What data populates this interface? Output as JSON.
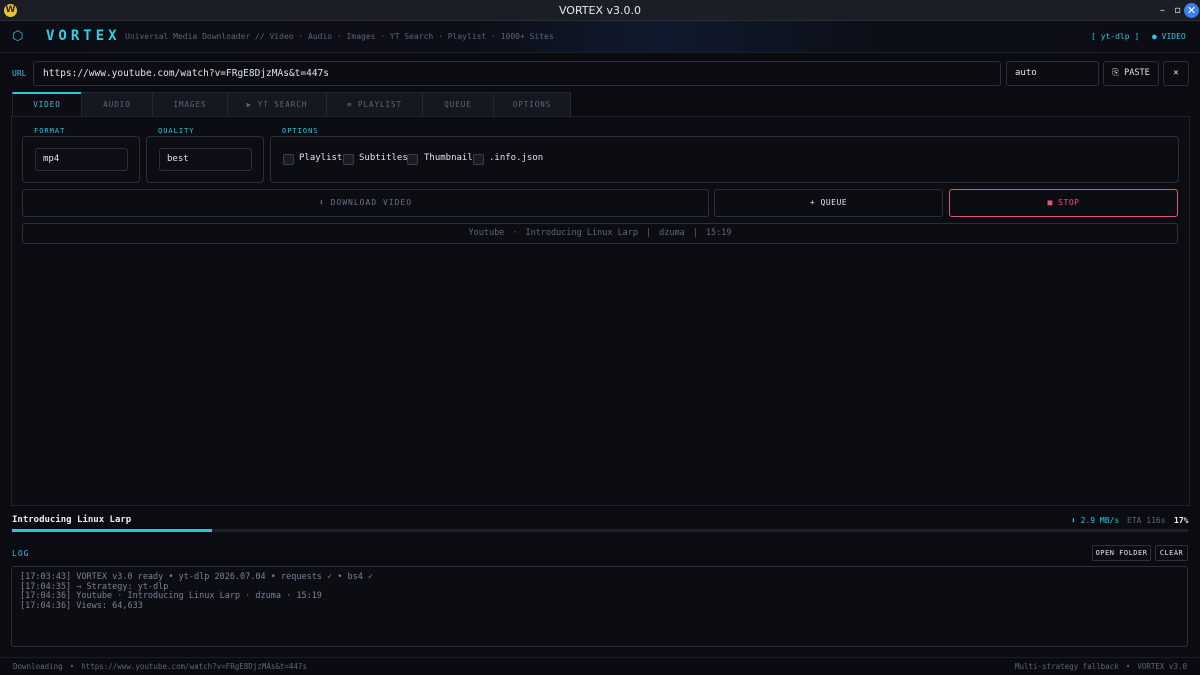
{
  "window": {
    "title": "VORTEX v3.0.0",
    "app_icon": "W",
    "minimize_glyph": "–",
    "maximize_glyph": "▫",
    "close_glyph": "✕"
  },
  "header": {
    "logo_icon": "⬡",
    "logo": "VORTEX",
    "tagline": "Universal Media Downloader  //  Video · Audio · Images · YT Search · Playlist · 1000+ Sites",
    "engine": "[ yt-dlp ]",
    "mode": "● VIDEO"
  },
  "url_row": {
    "label": "URL",
    "value": "https://www.youtube.com/watch?v=FRgE8DjzMAs&t=447s",
    "format_select": "auto",
    "paste_label": "⎘ PASTE",
    "clear_label": "✕"
  },
  "tabs": [
    {
      "label": "VIDEO",
      "active": true
    },
    {
      "label": "AUDIO",
      "active": false
    },
    {
      "label": "IMAGES",
      "active": false
    },
    {
      "label": "▶ YT SEARCH",
      "active": false
    },
    {
      "label": "≡ PLAYLIST",
      "active": false
    },
    {
      "label": "QUEUE",
      "active": false
    },
    {
      "label": "OPTIONS",
      "active": false
    }
  ],
  "video_tab": {
    "format_label": "FORMAT",
    "format_value": "mp4",
    "quality_label": "QUALITY",
    "quality_value": "best",
    "options_label": "OPTIONS",
    "options": [
      {
        "label": "Playlist",
        "checked": false
      },
      {
        "label": "Subtitles",
        "checked": false
      },
      {
        "label": "Thumbnail",
        "checked": false
      },
      {
        "label": ".info.json",
        "checked": false
      }
    ],
    "download_label": "⬇  DOWNLOAD VIDEO",
    "queue_label": "+ QUEUE",
    "stop_label": "■ STOP",
    "info": {
      "site": "Youtube",
      "dot": "·",
      "title": "Introducing Linux Larp",
      "sep": "|",
      "uploader": "dzuma",
      "duration": "15:19"
    }
  },
  "progress": {
    "title": "Introducing Linux Larp",
    "speed": "⬇ 2.9 MB/s",
    "eta": "ETA 116s",
    "percent_label": "17%",
    "percent": 17,
    "fill_color": "#26c6e0"
  },
  "log": {
    "label": "LOG",
    "open_folder_label": "OPEN FOLDER",
    "clear_label": "CLEAR",
    "lines": [
      "[17:03:43] VORTEX v3.0 ready • yt-dlp 2026.07.04 • requests ✓ • bs4 ✓",
      "[17:04:35] → Strategy: yt-dlp",
      "[17:04:36] Youtube · Introducing Linux Larp · dzuma · 15:19",
      "[17:04:36] Views: 64,633"
    ]
  },
  "status_bar": {
    "state": "Downloading",
    "dot": "•",
    "url": "https://www.youtube.com/watch?v=FRgE8DjzMAs&t=447s",
    "strategy": "Multi-strategy fallback",
    "version": "VORTEX v3.0"
  },
  "colors": {
    "accent": "#26c6e0",
    "stop": "#e0566a",
    "background": "#0b0c12"
  }
}
